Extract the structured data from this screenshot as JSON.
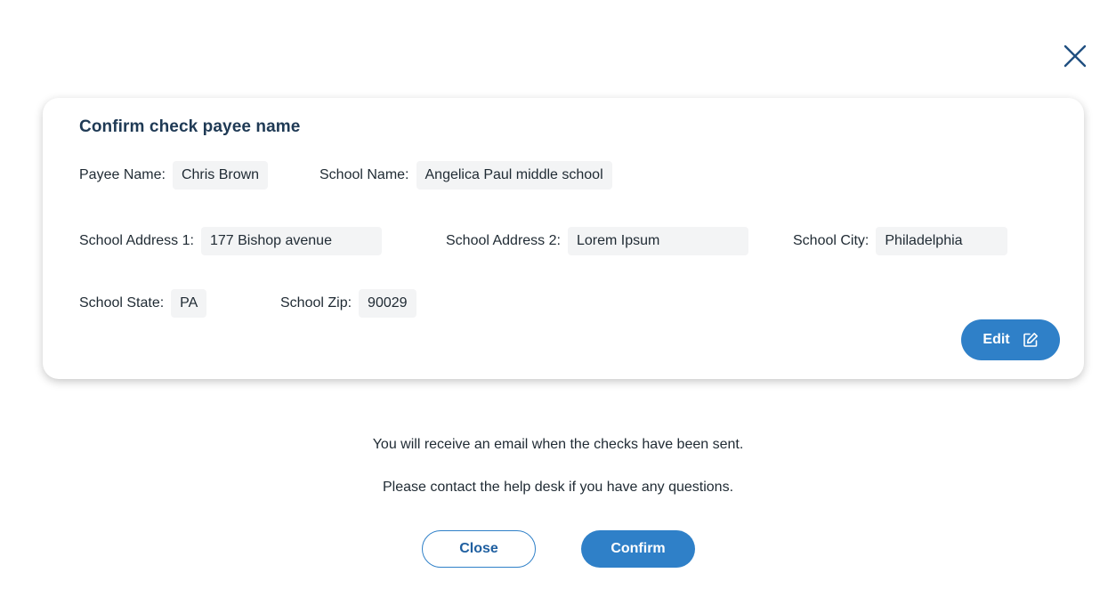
{
  "dialog": {
    "card_title": "Confirm check payee name",
    "fields": {
      "payee_name": {
        "label": "Payee Name:",
        "value": "Chris Brown"
      },
      "school_name": {
        "label": "School Name:",
        "value": "Angelica Paul middle school"
      },
      "school_address_1": {
        "label": "School Address 1:",
        "value": "177 Bishop avenue"
      },
      "school_address_2": {
        "label": "School Address 2:",
        "value": "Lorem Ipsum"
      },
      "school_city": {
        "label": "School City:",
        "value": "Philadelphia"
      },
      "school_state": {
        "label": "School State:",
        "value": "PA"
      },
      "school_zip": {
        "label": "School Zip:",
        "value": "90029"
      }
    },
    "edit_label": "Edit",
    "message_1": "You will receive an email when the checks have been sent.",
    "message_2": "Please contact the help desk if you have any questions.",
    "close_label": "Close",
    "confirm_label": "Confirm"
  },
  "icons": {
    "close": "close-icon",
    "edit": "edit-icon"
  },
  "colors": {
    "primary": "#2f80c8",
    "title": "#1f3a55",
    "field_bg": "#f3f4f5",
    "close_icon": "#1f4f80"
  }
}
